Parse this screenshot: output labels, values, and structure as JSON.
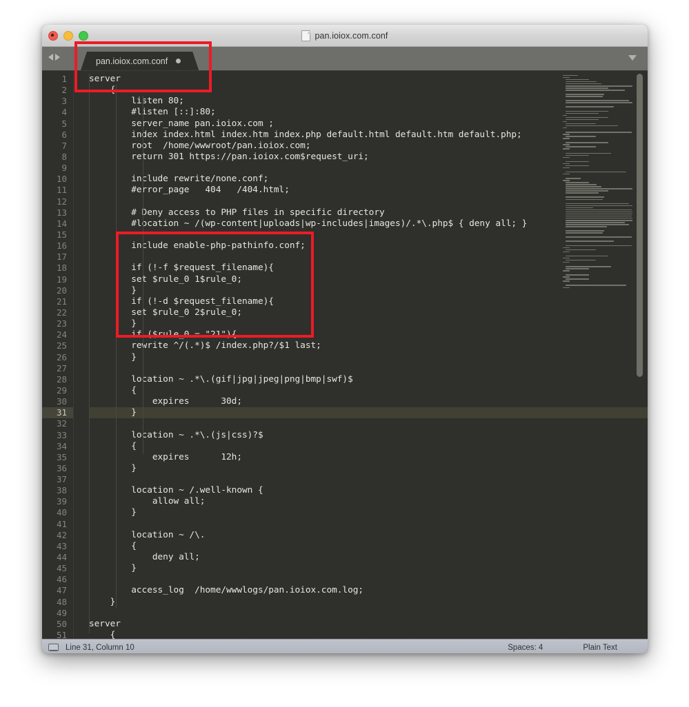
{
  "window": {
    "title": "pan.ioiox.com.conf",
    "doc_icon": "document-icon",
    "traffic_lights": {
      "close": "close-button",
      "minimize": "minimize-button",
      "zoom": "zoom-button"
    }
  },
  "tabbar": {
    "nav_back_icon": "arrow-left-icon",
    "nav_forward_icon": "arrow-right-icon",
    "tab_label": "pan.ioiox.com.conf",
    "dirty_indicator": "unsaved-dot-icon",
    "overflow_icon": "chevron-down-icon"
  },
  "editor": {
    "active_line": 31,
    "first_visible_line": 1,
    "lines": [
      {
        "n": 1,
        "text": "server"
      },
      {
        "n": 2,
        "text": "    {"
      },
      {
        "n": 3,
        "text": "        listen 80;"
      },
      {
        "n": 4,
        "text": "        #listen [::]:80;"
      },
      {
        "n": 5,
        "text": "        server_name pan.ioiox.com ;"
      },
      {
        "n": 6,
        "text": "        index index.html index.htm index.php default.html default.htm default.php;"
      },
      {
        "n": 7,
        "text": "        root  /home/wwwroot/pan.ioiox.com;"
      },
      {
        "n": 8,
        "text": "        return 301 https://pan.ioiox.com$request_uri;"
      },
      {
        "n": 9,
        "text": ""
      },
      {
        "n": 10,
        "text": "        include rewrite/none.conf;"
      },
      {
        "n": 11,
        "text": "        #error_page   404   /404.html;"
      },
      {
        "n": 12,
        "text": ""
      },
      {
        "n": 13,
        "text": "        # Deny access to PHP files in specific directory"
      },
      {
        "n": 14,
        "text": "        #location ~ /(wp-content|uploads|wp-includes|images)/.*\\.php$ { deny all; }"
      },
      {
        "n": 15,
        "text": ""
      },
      {
        "n": 16,
        "text": "        include enable-php-pathinfo.conf;"
      },
      {
        "n": 17,
        "text": ""
      },
      {
        "n": 18,
        "text": "        if (!-f $request_filename){"
      },
      {
        "n": 19,
        "text": "        set $rule_0 1$rule_0;"
      },
      {
        "n": 20,
        "text": "        }"
      },
      {
        "n": 21,
        "text": "        if (!-d $request_filename){"
      },
      {
        "n": 22,
        "text": "        set $rule_0 2$rule_0;"
      },
      {
        "n": 23,
        "text": "        }"
      },
      {
        "n": 24,
        "text": "        if ($rule_0 = \"21\"){"
      },
      {
        "n": 25,
        "text": "        rewrite ^/(.*)$ /index.php?/$1 last;"
      },
      {
        "n": 26,
        "text": "        }"
      },
      {
        "n": 27,
        "text": ""
      },
      {
        "n": 28,
        "text": "        location ~ .*\\.(gif|jpg|jpeg|png|bmp|swf)$"
      },
      {
        "n": 29,
        "text": "        {"
      },
      {
        "n": 30,
        "text": "            expires      30d;"
      },
      {
        "n": 31,
        "text": "        }"
      },
      {
        "n": 32,
        "text": ""
      },
      {
        "n": 33,
        "text": "        location ~ .*\\.(js|css)?$"
      },
      {
        "n": 34,
        "text": "        {"
      },
      {
        "n": 35,
        "text": "            expires      12h;"
      },
      {
        "n": 36,
        "text": "        }"
      },
      {
        "n": 37,
        "text": ""
      },
      {
        "n": 38,
        "text": "        location ~ /.well-known {"
      },
      {
        "n": 39,
        "text": "            allow all;"
      },
      {
        "n": 40,
        "text": "        }"
      },
      {
        "n": 41,
        "text": ""
      },
      {
        "n": 42,
        "text": "        location ~ /\\."
      },
      {
        "n": 43,
        "text": "        {"
      },
      {
        "n": 44,
        "text": "            deny all;"
      },
      {
        "n": 45,
        "text": "        }"
      },
      {
        "n": 46,
        "text": ""
      },
      {
        "n": 47,
        "text": "        access_log  /home/wwwlogs/pan.ioiox.com.log;"
      },
      {
        "n": 48,
        "text": "    }"
      },
      {
        "n": 49,
        "text": ""
      },
      {
        "n": 50,
        "text": "server"
      },
      {
        "n": 51,
        "text": "    {"
      }
    ]
  },
  "minimap": {
    "widths": [
      22,
      10,
      34,
      45,
      52,
      120,
      62,
      86,
      0,
      56,
      54,
      0,
      92,
      140,
      0,
      70,
      0,
      62,
      48,
      6,
      62,
      48,
      6,
      44,
      76,
      6,
      0,
      96,
      10,
      44,
      10,
      0,
      62,
      10,
      44,
      10,
      0,
      66,
      34,
      10,
      0,
      34,
      10,
      34,
      10,
      0,
      88,
      10,
      0,
      22,
      10,
      34,
      45,
      52,
      120,
      62,
      48,
      0,
      56,
      54,
      0,
      92,
      140,
      40,
      96,
      120,
      110,
      96,
      150,
      104,
      86,
      92,
      60,
      0,
      56,
      54,
      0,
      96,
      0,
      70,
      0,
      96,
      10,
      44,
      10,
      0,
      62,
      10,
      44,
      10,
      0,
      66,
      34,
      10,
      0,
      34,
      10,
      34,
      10,
      0,
      88,
      10
    ]
  },
  "statusbar": {
    "monitor_icon": "monitor-icon",
    "cursor_position": "Line 31, Column 10",
    "indentation": "Spaces: 4",
    "syntax": "Plain Text"
  },
  "annotations": {
    "box_1_label": "red-highlight-box-server-listen",
    "box_2_label": "red-highlight-box-rewrite-rules",
    "color": "#ec1c24"
  }
}
